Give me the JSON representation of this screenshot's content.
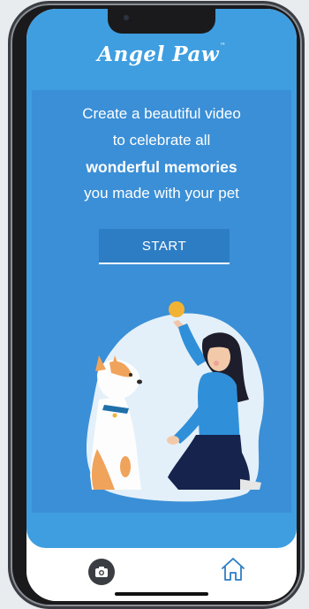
{
  "app": {
    "brand_name": "Angel Paw",
    "brand_mark": "™"
  },
  "hero": {
    "line1": "Create a beautiful video",
    "line2": "to celebrate all",
    "line3": "wonderful memories",
    "line4": "you made with your pet"
  },
  "cta": {
    "start_label": "START"
  },
  "tabbar": {
    "items": [
      {
        "icon": "camera-icon"
      },
      {
        "icon": "home-icon"
      }
    ]
  },
  "colors": {
    "background_blue": "#3f9ee0",
    "panel_blue": "#3a8fd6",
    "button_blue": "#2d7dc4",
    "white": "#ffffff"
  }
}
